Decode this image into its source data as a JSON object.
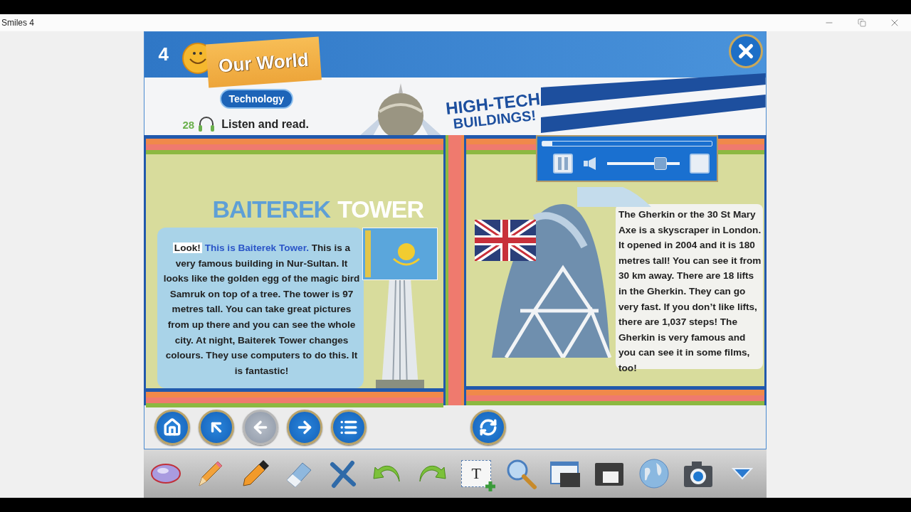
{
  "window": {
    "title": "Smiles 4"
  },
  "header": {
    "unit_number": "4",
    "unit_title": "Our World",
    "topic": "Technology",
    "track": "28",
    "instruction": "Listen and read.",
    "headline": [
      "HIGH-TECH",
      "BUILDINGS!"
    ]
  },
  "left_page": {
    "title": [
      "BAITEREK",
      "TOWER"
    ],
    "paragraph": [
      "Look!",
      "This is Baiterek Tower.",
      "This is a very famous building in Nur-Sultan. It looks like the golden egg of the magic bird Samruk on top of a tree. The tower is 97 metres tall. You can take great  pictures from up there and you can see the whole city. At night, Baiterek Tower changes colours. They use computers to do this. It is fantastic!"
    ]
  },
  "audio_player": {
    "playing": true,
    "progress": {
      "level": 0.06
    },
    "volume": {
      "level": 0.78
    }
  },
  "right_page": {
    "paragraph": "The Gherkin or the 30 St Mary Axe is a skyscraper in London. It opened in 2004 and it is 180 metres tall! You can see it from 30 km away. There are 18 lifts in the Gherkin. They can go very fast. If you don’t like lifts, there are 1,037 steps! The Gherkin is very famous and you can see it in some films, too!"
  },
  "navigation": [
    {
      "kind": "home",
      "disabled": false
    },
    {
      "kind": "up",
      "disabled": false
    },
    {
      "kind": "back",
      "disabled": true
    },
    {
      "kind": "forward",
      "disabled": false
    },
    {
      "kind": "contents",
      "disabled": false
    },
    {
      "kind": "gap"
    },
    {
      "kind": "refresh",
      "disabled": false
    }
  ],
  "toolbar": [
    {
      "kind": "lasso"
    },
    {
      "kind": "pencil"
    },
    {
      "kind": "marker"
    },
    {
      "kind": "eraser"
    },
    {
      "kind": "clear"
    },
    {
      "kind": "undo"
    },
    {
      "kind": "redo"
    },
    {
      "kind": "text",
      "glyph": "T"
    },
    {
      "kind": "zoom"
    },
    {
      "kind": "window"
    },
    {
      "kind": "screen"
    },
    {
      "kind": "globe"
    },
    {
      "kind": "camera"
    },
    {
      "kind": "more"
    }
  ]
}
